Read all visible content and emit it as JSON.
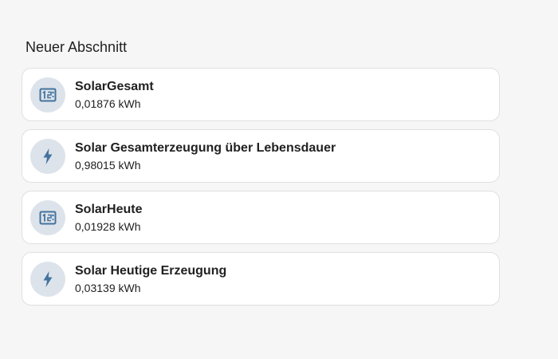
{
  "section": {
    "title": "Neuer Abschnitt"
  },
  "entities": [
    {
      "name": "SolarGesamt",
      "value": "0,01876 kWh",
      "icon": "counter-icon"
    },
    {
      "name": "Solar Gesamterzeugung über Lebensdauer",
      "value": "0,98015 kWh",
      "icon": "lightning-bolt-icon"
    },
    {
      "name": "SolarHeute",
      "value": "0,01928 kWh",
      "icon": "counter-icon"
    },
    {
      "name": "Solar Heutige Erzeugung",
      "value": "0,03139 kWh",
      "icon": "lightning-bolt-icon"
    }
  ],
  "colors": {
    "icon": "#44739e",
    "icon_background": "#dde3ea",
    "card_background": "#ffffff",
    "page_background": "#f6f6f6"
  }
}
